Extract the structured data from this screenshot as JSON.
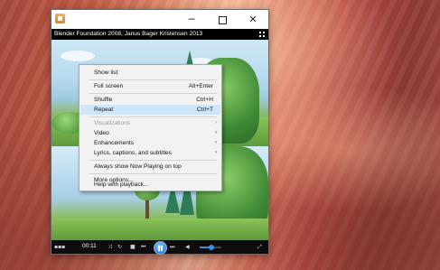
{
  "window": {
    "caption": "Blender Foundation 2008, Janus Bager Kristensen 2013",
    "minimize_glyph": "─",
    "close_glyph": "✕"
  },
  "controls": {
    "elapsed_time": "00:11",
    "shuffle_glyph": "⤨",
    "repeat_glyph": "↻",
    "stop_glyph": "■",
    "prev_glyph": "⏮",
    "next_glyph": "⏭",
    "mute_glyph": "◀",
    "fullscreen_glyph": "⤢",
    "volume_level": 0.55
  },
  "context_menu": {
    "items": [
      {
        "label": "Show list",
        "shortcut": "",
        "arrow": ""
      },
      {
        "label": "Full screen",
        "shortcut": "Alt+Enter",
        "arrow": ""
      },
      {
        "label": "Shuffle",
        "shortcut": "Ctrl+H",
        "arrow": ""
      },
      {
        "label": "Repeat",
        "shortcut": "Ctrl+T",
        "arrow": ""
      },
      {
        "label": "Visualizations",
        "shortcut": "",
        "arrow": "›"
      },
      {
        "label": "Video",
        "shortcut": "",
        "arrow": "›"
      },
      {
        "label": "Enhancements",
        "shortcut": "",
        "arrow": "›"
      },
      {
        "label": "Lyrics, captions, and subtitles",
        "shortcut": "",
        "arrow": "›"
      },
      {
        "label": "Always show Now Playing on top",
        "shortcut": "",
        "arrow": ""
      },
      {
        "label": "More options...",
        "shortcut": "",
        "arrow": ""
      },
      {
        "label": "Help with playback...",
        "shortcut": "",
        "arrow": ""
      }
    ]
  }
}
